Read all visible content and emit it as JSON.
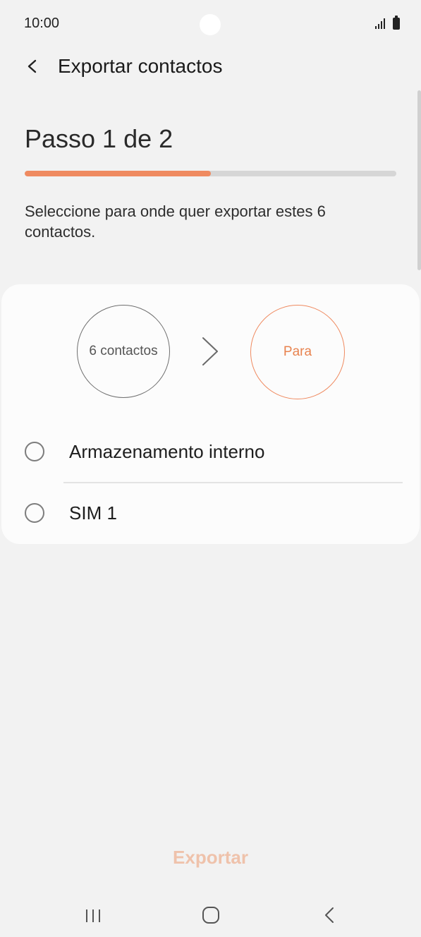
{
  "status_bar": {
    "time": "10:00",
    "icons": [
      "signal-icon",
      "battery-icon"
    ]
  },
  "header": {
    "title": "Exportar contactos",
    "back_icon": "back-arrow-icon"
  },
  "step": {
    "title": "Passo 1 de 2",
    "progress_percent": 50,
    "instruction": "Seleccione para onde quer exportar estes 6 contactos."
  },
  "flow": {
    "from_label": "6 contactos",
    "arrow_icon": "chevron-right-icon",
    "to_label": "Para"
  },
  "options": [
    {
      "label": "Armazenamento interno",
      "selected": false
    },
    {
      "label": "SIM 1",
      "selected": false
    }
  ],
  "actions": {
    "export_label": "Exportar"
  },
  "navigation": {
    "icons": [
      "recent-apps-icon",
      "home-icon",
      "back-icon"
    ]
  },
  "colors": {
    "accent": "#ef8a60",
    "background": "#f2f2f2",
    "card": "#fcfcfc",
    "disabled_accent": "#efc2ab"
  }
}
